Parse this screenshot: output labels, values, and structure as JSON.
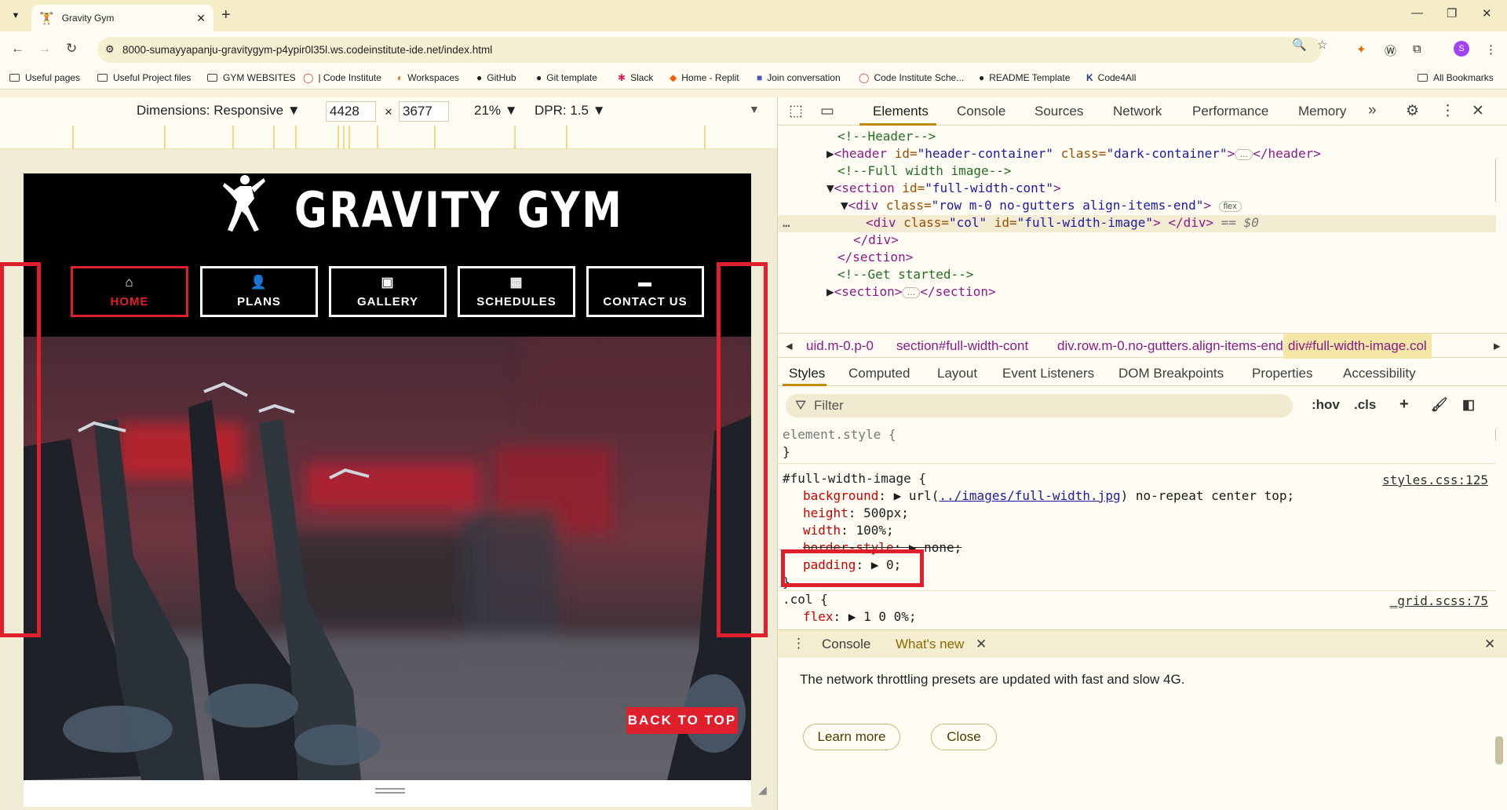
{
  "browser": {
    "tab_title": "Gravity Gym",
    "url": "8000-sumayyapanju-gravitygym-p4ypir0l35l.ws.codeinstitute-ide.net/index.html",
    "profile_initial": "S"
  },
  "bookmarks": [
    {
      "label": "Useful pages"
    },
    {
      "label": "Useful Project files"
    },
    {
      "label": "GYM WEBSITES"
    },
    {
      "label": "| Code Institute"
    },
    {
      "label": "Workspaces"
    },
    {
      "label": "GitHub"
    },
    {
      "label": "Git template"
    },
    {
      "label": "Slack"
    },
    {
      "label": "Home - Replit"
    },
    {
      "label": "Join conversation"
    },
    {
      "label": "Code Institute Sche..."
    },
    {
      "label": "README Template"
    },
    {
      "label": "Code4All"
    },
    {
      "label": "All Bookmarks"
    }
  ],
  "device_toolbar": {
    "dimensions_label": "Dimensions: Responsive",
    "width": "4428",
    "times": "×",
    "height": "3677",
    "zoom": "21%",
    "dpr": "DPR: 1.5"
  },
  "site": {
    "title": "GRAVITY GYM",
    "nav": [
      {
        "label": "HOME",
        "icon": "home-icon",
        "active": true
      },
      {
        "label": "PLANS",
        "icon": "user-icon",
        "active": false
      },
      {
        "label": "GALLERY",
        "icon": "image-icon",
        "active": false
      },
      {
        "label": "SCHEDULES",
        "icon": "calendar-icon",
        "active": false
      },
      {
        "label": "CONTACT US",
        "icon": "comment-icon",
        "active": false
      }
    ],
    "back_to_top": "BACK TO TOP",
    "accent_color": "#e01f2d"
  },
  "devtools": {
    "tabs": [
      "Elements",
      "Console",
      "Sources",
      "Network",
      "Performance",
      "Memory"
    ],
    "active_tab": "Elements",
    "dom": {
      "l1": "<!--Header-->",
      "l2_tag": "<header ",
      "l2_a1n": "id=",
      "l2_a1v": "\"header-container\"",
      "l2_a2n": " class=",
      "l2_a2v": "\"dark-container\"",
      "l2_end": "</header>",
      "l3": "<!--Full width image-->",
      "l4_tag": "<section ",
      "l4_a1n": "id=",
      "l4_a1v": "\"full-width-cont\"",
      "l4_end": ">",
      "l5_tag": "<div ",
      "l5_a1n": "class=",
      "l5_a1v": "\"row m-0 no-gutters align-items-end\"",
      "l5_end": ">",
      "l5_badge": "flex",
      "l6_tag": "<div ",
      "l6_a1n": "class=",
      "l6_a1v": "\"col\"",
      "l6_a2n": " id=",
      "l6_a2v": "\"full-width-image\"",
      "l6_end": "> </div>",
      "l6_ref": " == $0",
      "l7": "</div>",
      "l8": "</section>",
      "l9": "<!--Get started-->",
      "l10_tag": "<section>",
      "l10_end": "</section>"
    },
    "breadcrumbs": [
      "uid.m-0.p-0",
      "section#full-width-cont",
      "div.row.m-0.no-gutters.align-items-end",
      "div#full-width-image.col"
    ],
    "subtabs": [
      "Styles",
      "Computed",
      "Layout",
      "Event Listeners",
      "DOM Breakpoints",
      "Properties",
      "Accessibility"
    ],
    "filter_placeholder": "Filter",
    "filter_buttons": [
      ":hov",
      ".cls"
    ],
    "styles": {
      "element_style": "element.style {",
      "close_brace": "}",
      "rule1_selector": "#full-width-image {",
      "rule1_source": "styles.css:125",
      "bg_prop": "background",
      "bg_val_pre": ": ▶ url(",
      "bg_url": "../images/full-width.jpg",
      "bg_val_post": ") no-repeat center top;",
      "height_prop": "height",
      "height_val": ": 500px;",
      "width_prop": "width",
      "width_val": ": 100%;",
      "border_prop": "border-style",
      "border_val": ": ▶ none;",
      "padding_prop": "padding",
      "padding_val": ": ▶ 0;",
      "rule2_selector": ".col {",
      "rule2_source": "_grid.scss:75",
      "flex_prop": "flex",
      "flex_val": ": ▶ 1 0 0%;"
    },
    "drawer": {
      "tabs": [
        "Console",
        "What's new"
      ],
      "message": "The network throttling presets are updated with fast and slow 4G.",
      "learn_more": "Learn more",
      "close": "Close"
    }
  }
}
